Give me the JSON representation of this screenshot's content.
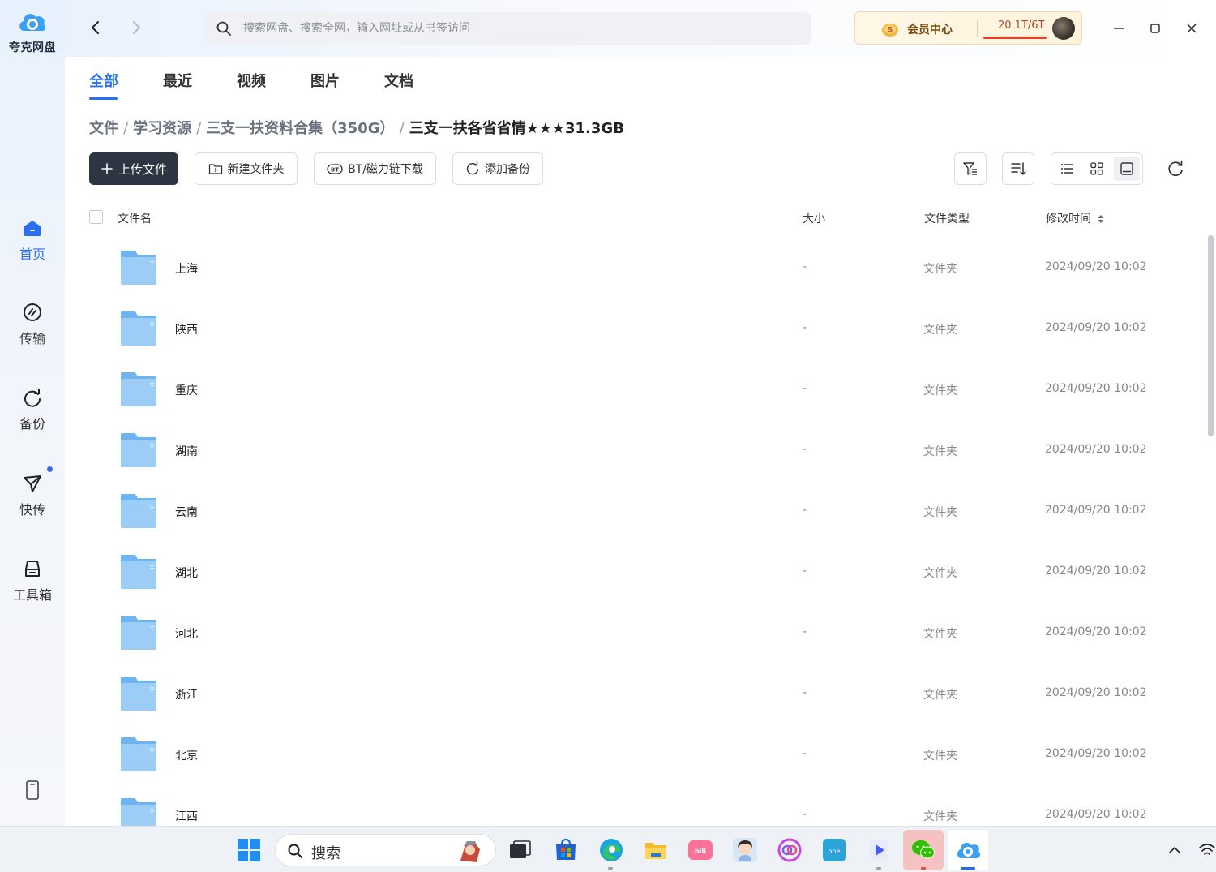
{
  "app": {
    "name": "夸克网盘"
  },
  "sidebar": {
    "items": [
      {
        "label": "首页",
        "icon": "home-icon",
        "active": true
      },
      {
        "label": "传输",
        "icon": "transfer-icon",
        "active": false
      },
      {
        "label": "备份",
        "icon": "backup-icon",
        "active": false
      },
      {
        "label": "快传",
        "icon": "quick-send-icon",
        "active": false,
        "badge": true
      },
      {
        "label": "工具箱",
        "icon": "toolbox-icon",
        "active": false
      }
    ]
  },
  "search": {
    "placeholder": "搜索网盘、搜索全网，输入网址或从书签访问"
  },
  "vip": {
    "label": "会员中心",
    "storage": "20.1T/6T",
    "storage_fraction": 1.0
  },
  "tabs": [
    {
      "label": "全部",
      "active": true
    },
    {
      "label": "最近",
      "active": false
    },
    {
      "label": "视频",
      "active": false
    },
    {
      "label": "图片",
      "active": false
    },
    {
      "label": "文档",
      "active": false
    }
  ],
  "breadcrumb": {
    "items": [
      "文件",
      "学习资源",
      "三支一扶资料合集（350G）"
    ],
    "separator": "/",
    "current": "三支一扶各省省情★★★31.3GB"
  },
  "toolbar": {
    "upload": "上传文件",
    "new_folder": "新建文件夹",
    "bt_download": "BT/磁力链下载",
    "add_backup": "添加备份"
  },
  "table": {
    "headers": {
      "name": "文件名",
      "size": "大小",
      "type": "文件类型",
      "modified": "修改时间"
    },
    "rows": [
      {
        "name": "上海",
        "size": "-",
        "type": "文件夹",
        "modified": "2024/09/20 10:02"
      },
      {
        "name": "陕西",
        "size": "-",
        "type": "文件夹",
        "modified": "2024/09/20 10:02"
      },
      {
        "name": "重庆",
        "size": "-",
        "type": "文件夹",
        "modified": "2024/09/20 10:02"
      },
      {
        "name": "湖南",
        "size": "-",
        "type": "文件夹",
        "modified": "2024/09/20 10:02"
      },
      {
        "name": "云南",
        "size": "-",
        "type": "文件夹",
        "modified": "2024/09/20 10:02"
      },
      {
        "name": "湖北",
        "size": "-",
        "type": "文件夹",
        "modified": "2024/09/20 10:02"
      },
      {
        "name": "河北",
        "size": "-",
        "type": "文件夹",
        "modified": "2024/09/20 10:02"
      },
      {
        "name": "浙江",
        "size": "-",
        "type": "文件夹",
        "modified": "2024/09/20 10:02"
      },
      {
        "name": "北京",
        "size": "-",
        "type": "文件夹",
        "modified": "2024/09/20 10:02"
      },
      {
        "name": "江西",
        "size": "-",
        "type": "文件夹",
        "modified": "2024/09/20 10:02"
      }
    ]
  },
  "taskbar": {
    "search_label": "搜索",
    "apps": [
      "start-icon",
      "task-view-icon",
      "store-icon",
      "edge-icon",
      "file-explorer-icon",
      "bilibili-icon",
      "avatar-app-icon",
      "link-app-icon",
      "onenote-icon",
      "media-player-icon",
      "wechat-icon",
      "quark-drive-icon"
    ]
  },
  "colors": {
    "accent": "#2b6ef6",
    "folder": "#8ec5f5",
    "primary_button": "#2e3442"
  }
}
